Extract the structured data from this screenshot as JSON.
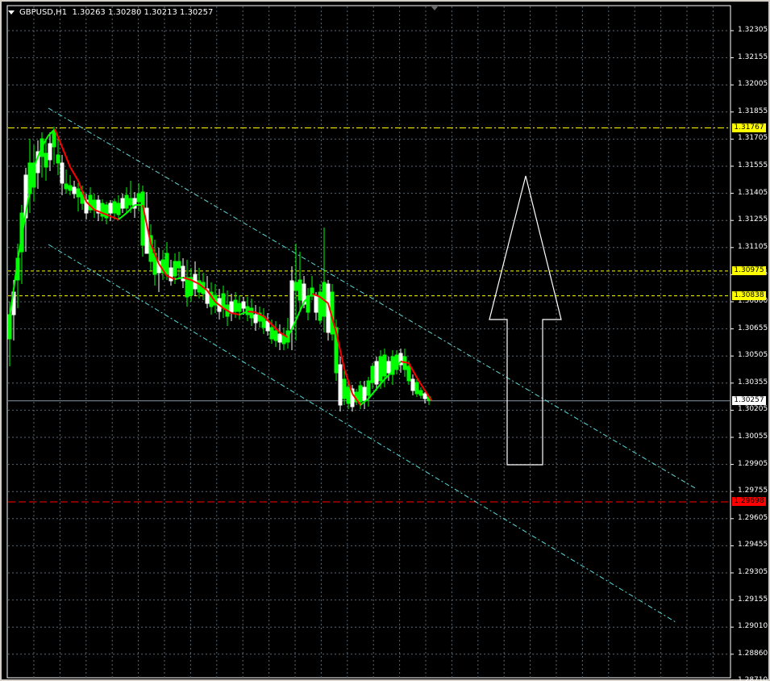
{
  "header": {
    "symbol": "GBPUSD,H1",
    "ohlc": "1.30263 1.30280 1.30213 1.30257"
  },
  "price_axis": [
    "1.32305",
    "1.32155",
    "1.32005",
    "1.31855",
    "1.31705",
    "1.31555",
    "1.31405",
    "1.31255",
    "1.31105",
    "1.30955",
    "1.30800",
    "1.30655",
    "1.30505",
    "1.30355",
    "1.30205",
    "1.30055",
    "1.29905",
    "1.29755",
    "1.29605",
    "1.29455",
    "1.29305",
    "1.29155",
    "1.29010",
    "1.28860",
    "1.28710"
  ],
  "price_tags": [
    {
      "name": "resistance-line-1-tag",
      "label": "1.31767",
      "bg": "#ffff00",
      "fg": "#000000",
      "price": 1.31767
    },
    {
      "name": "resistance-line-2-tag",
      "label": "1.30975",
      "bg": "#ffff00",
      "fg": "#000000",
      "price": 1.30975
    },
    {
      "name": "resistance-line-3-tag",
      "label": "1.30838",
      "bg": "#ffff00",
      "fg": "#000000",
      "price": 1.30838
    },
    {
      "name": "bid-line-tag",
      "label": "1.30257",
      "bg": "#ffffff",
      "fg": "#000000",
      "price": 1.30257
    },
    {
      "name": "support-line-tag",
      "label": "1.29698",
      "bg": "#ff0000",
      "fg": "#000000",
      "price": 1.29698
    }
  ],
  "colors": {
    "background": "#000000",
    "grid": "#5a6670",
    "bull": "#00ff00",
    "bear": "#ffffff",
    "ma_up": "#00ff00",
    "ma_down": "#ff0000",
    "channel": "#5fd7d7",
    "level": "#ffff00",
    "support": "#ff0000",
    "bid": "#8a96a3",
    "arrow": "#ffffff"
  },
  "icons": {
    "menu": "menu-triangle-icon",
    "scroll": "chart-shift-icon"
  }
}
